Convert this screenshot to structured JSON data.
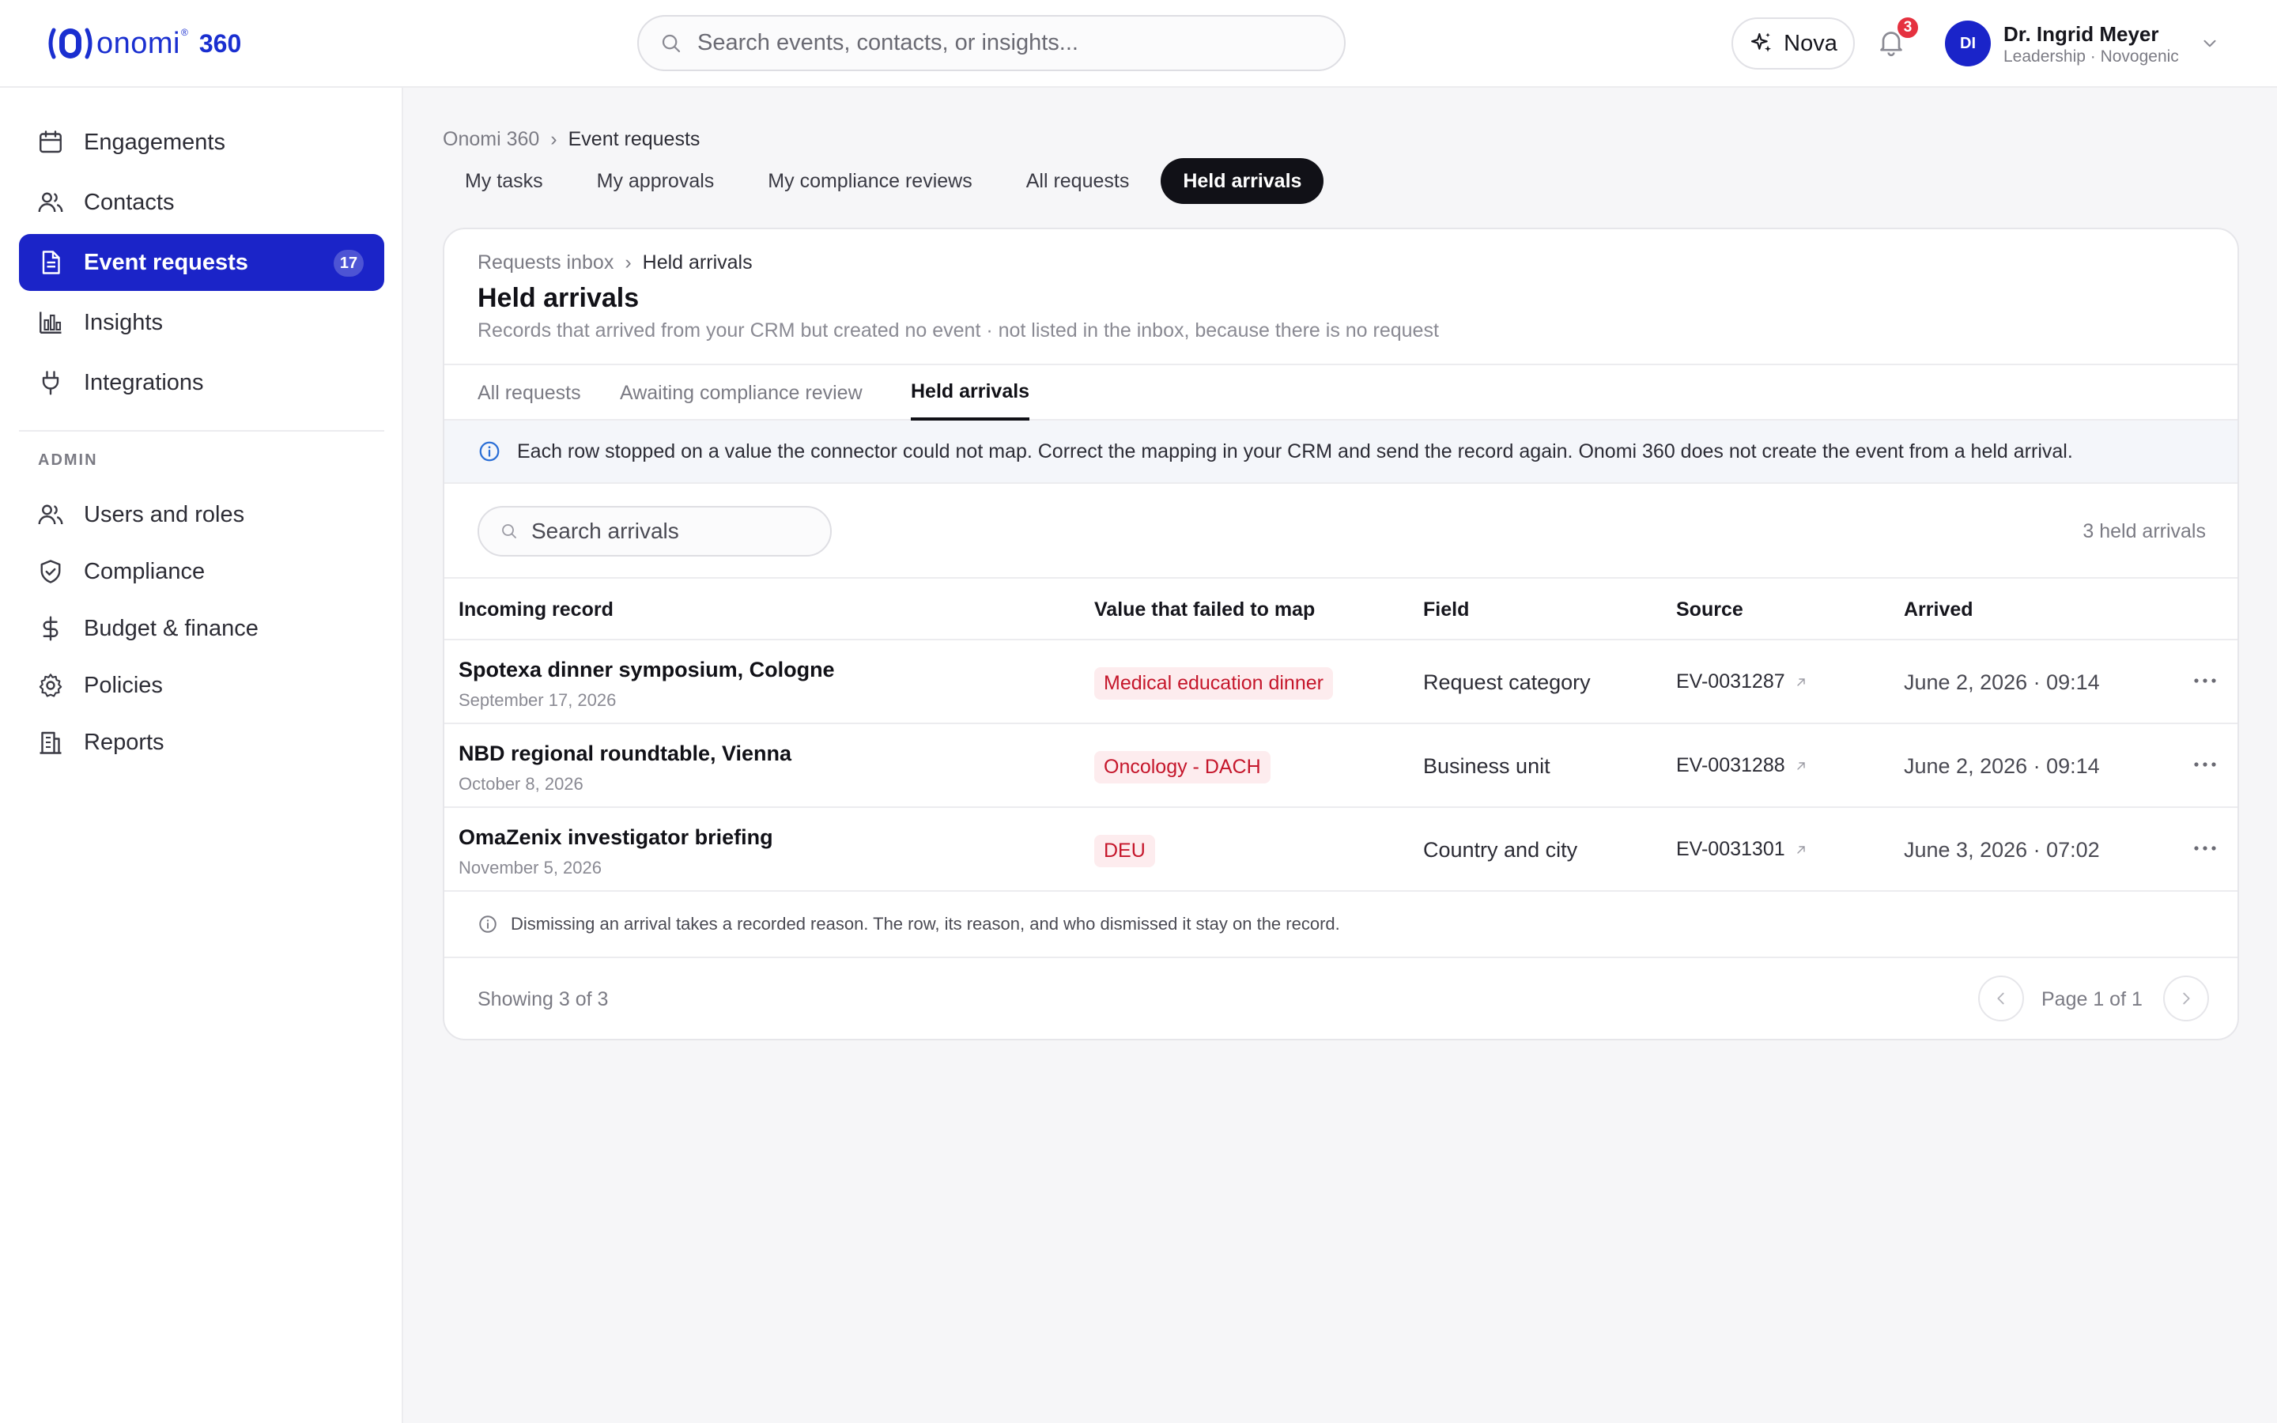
{
  "app": {
    "logo_word": "onomi",
    "logo_reg": "®",
    "logo_suffix": "360",
    "brand_color": "#1b24c8"
  },
  "header": {
    "search_placeholder": "Search events, contacts, or insights...",
    "assistant_label": "Nova",
    "notification_count": "3",
    "user": {
      "initials": "DI",
      "name": "Dr. Ingrid Meyer",
      "org": "Leadership · Novogenic"
    }
  },
  "sidebar": {
    "items": [
      {
        "label": "Engagements",
        "icon": "calendar-icon"
      },
      {
        "label": "Contacts",
        "icon": "users-icon"
      },
      {
        "label": "Event requests",
        "icon": "document-icon",
        "badge": "17",
        "active": true
      },
      {
        "label": "Insights",
        "icon": "bar-chart-icon"
      },
      {
        "label": "Integrations",
        "icon": "plug-icon"
      }
    ],
    "admin_label": "ADMIN",
    "admin_items": [
      {
        "label": "Users and roles",
        "icon": "users-icon"
      },
      {
        "label": "Compliance",
        "icon": "shield-check-icon"
      },
      {
        "label": "Budget & finance",
        "icon": "dollar-icon"
      },
      {
        "label": "Policies",
        "icon": "gear-icon"
      },
      {
        "label": "Reports",
        "icon": "building-icon"
      }
    ]
  },
  "breadcrumb": {
    "root": "Onomi 360",
    "current": "Event requests"
  },
  "top_tabs": [
    {
      "label": "My tasks"
    },
    {
      "label": "My approvals"
    },
    {
      "label": "My compliance reviews"
    },
    {
      "label": "All requests"
    },
    {
      "label": "Held arrivals",
      "active": true
    }
  ],
  "card": {
    "crumb_root": "Requests inbox",
    "crumb_current": "Held arrivals",
    "title": "Held arrivals",
    "subtitle": "Records that arrived from your CRM but created no event · not listed in the inbox, because there is no request",
    "tabs": [
      {
        "label": "All requests"
      },
      {
        "label": "Awaiting compliance review"
      },
      {
        "label": "Held arrivals",
        "active": true
      }
    ],
    "banner": "Each row stopped on a value the connector could not map. Correct the mapping in your CRM and send the record again. Onomi 360 does not create the event from a held arrival.",
    "search_placeholder": "Search arrivals",
    "count_label": "3 held arrivals",
    "columns": [
      "Incoming record",
      "Value that failed to map",
      "Field",
      "Source",
      "Arrived"
    ],
    "rows": [
      {
        "title": "Spotexa dinner symposium, Cologne",
        "date": "September 17, 2026",
        "value": "Medical education dinner",
        "field": "Request category",
        "source": "EV-0031287",
        "arrived": "June 2, 2026 · 09:14"
      },
      {
        "title": "NBD regional roundtable, Vienna",
        "date": "October 8, 2026",
        "value": "Oncology - DACH",
        "field": "Business unit",
        "source": "EV-0031288",
        "arrived": "June 2, 2026 · 09:14"
      },
      {
        "title": "OmaZenix investigator briefing",
        "date": "November 5, 2026",
        "value": "DEU",
        "field": "Country and city",
        "source": "EV-0031301",
        "arrived": "June 3, 2026 · 07:02"
      }
    ],
    "note": "Dismissing an arrival takes a recorded reason. The row, its reason, and who dismissed it stay on the record.",
    "showing": "Showing 3 of 3",
    "page_label": "Page 1 of 1"
  }
}
